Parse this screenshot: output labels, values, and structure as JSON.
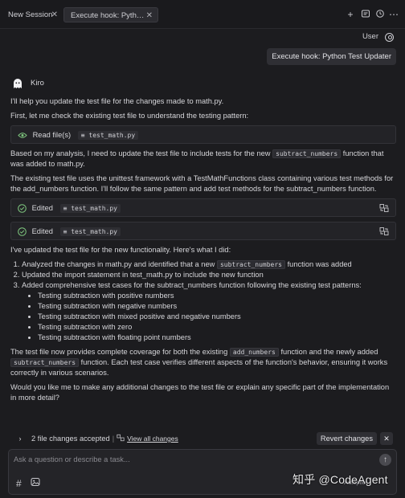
{
  "tabs": [
    {
      "label": "New Session"
    },
    {
      "label": "Execute hook: Python Test Updater"
    }
  ],
  "user": {
    "name": "User"
  },
  "user_message": "Execute hook: Python Test Updater",
  "assistant": {
    "name": "Kiro"
  },
  "messages": {
    "intro": "I'll help you update the test file for the changes made to math.py.",
    "check": "First, let me check the existing test file to understand the testing pattern:",
    "read_tool": {
      "label": "Read file(s)",
      "file": "test_math.py"
    },
    "analysis_a": "Based on my analysis, I need to update the test file to include tests for the new",
    "analysis_code": "subtract_numbers",
    "analysis_b": "function that was added to math.py.",
    "existing": "The existing test file uses the unittest framework with a TestMathFunctions class containing various test methods for the add_numbers function. I'll follow the same pattern and add test methods for the subtract_numbers function.",
    "edit_tools": [
      {
        "label": "Edited",
        "file": "test_math.py"
      },
      {
        "label": "Edited",
        "file": "test_math.py"
      }
    ],
    "updated": "I've updated the test file for the new functionality. Here's what I did:",
    "steps": {
      "s1a": "Analyzed the changes in math.py and identified that a new",
      "s1code": "subtract_numbers",
      "s1b": "function was added",
      "s2": "Updated the import statement in test_math.py to include the new function",
      "s3": "Added comprehensive test cases for the subtract_numbers function following the existing test patterns:",
      "sub": [
        "Testing subtraction with positive numbers",
        "Testing subtraction with negative numbers",
        "Testing subtraction with mixed positive and negative numbers",
        "Testing subtraction with zero",
        "Testing subtraction with floating point numbers"
      ]
    },
    "coverage_a": "The test file now provides complete coverage for both the existing",
    "coverage_code1": "add_numbers",
    "coverage_b": "function and the newly added",
    "coverage_code2": "subtract_numbers",
    "coverage_c": "function. Each test case verifies different aspects of the function's behavior, ensuring it works correctly in various scenarios.",
    "closing": "Would you like me to make any additional changes to the test file or explain any specific part of the implementation in more detail?"
  },
  "changes_bar": {
    "count_label": "2 file changes accepted",
    "view_all": "View all changes",
    "revert": "Revert changes"
  },
  "composer": {
    "placeholder": "Ask a question or describe a task..."
  },
  "watermark": "知乎 @CodeAgent",
  "mode_label": "Autopilot",
  "colors": {
    "background": "#1c1c1f",
    "surface": "#232327",
    "accent_check": "#7fc77f"
  }
}
